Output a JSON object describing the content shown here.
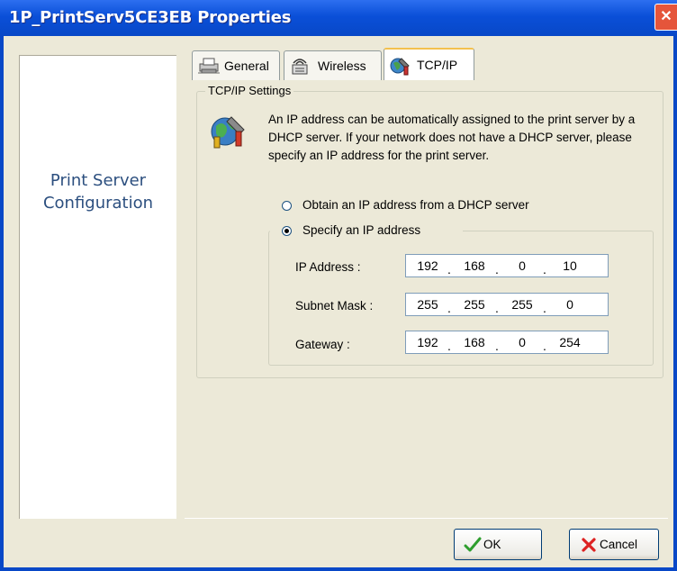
{
  "window": {
    "title": "1P_PrintServ5CE3EB Properties",
    "close_glyph": "✕"
  },
  "sidebar": {
    "line1": "Print Server",
    "line2": "Configuration",
    "text_color": "#2c4f7f"
  },
  "tabs": [
    {
      "label": "General",
      "icon": "printer-icon"
    },
    {
      "label": "Wireless",
      "icon": "wireless-icon"
    },
    {
      "label": "TCP/IP",
      "icon": "network-tools-icon",
      "active": true
    }
  ],
  "tcpip": {
    "group_title": "TCP/IP Settings",
    "description": "An IP address can be automatically assigned to the print server by a DHCP server. If your network does not have a DHCP server, please specify an IP address for the print server.",
    "option_dhcp": "Obtain an IP address from a DHCP server",
    "option_static": "Specify an IP address",
    "selected_option": "static",
    "fields": [
      {
        "label": "IP Address :",
        "octets": [
          "192",
          "168",
          "0",
          "10"
        ]
      },
      {
        "label": "Subnet Mask :",
        "octets": [
          "255",
          "255",
          "255",
          "0"
        ]
      },
      {
        "label": "Gateway :",
        "octets": [
          "192",
          "168",
          "0",
          "254"
        ]
      }
    ]
  },
  "buttons": {
    "ok": "OK",
    "cancel": "Cancel"
  },
  "colors": {
    "title_bar": "#0a4fd8",
    "dialog_bg": "#ece9d8",
    "active_tab_accent": "#f3c14e"
  }
}
